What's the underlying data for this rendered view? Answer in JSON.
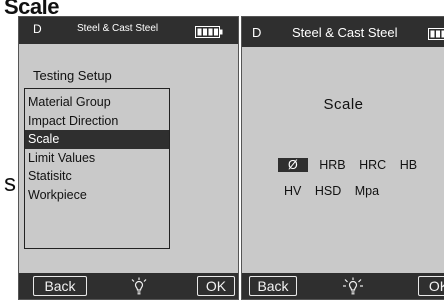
{
  "heading": "Scale",
  "side_letter": "s",
  "left_device": {
    "mode": "D",
    "title": "Steel & Cast Steel",
    "setup_title": "Testing Setup",
    "menu": [
      "Material Group",
      "Impact Direction",
      "Scale",
      "Limit Values",
      "Statisitc",
      "Workpiece"
    ],
    "selected_index": 2,
    "back_label": "Back",
    "ok_label": "OK",
    "icons": [
      "battery-icon",
      "light-bulb-icon"
    ]
  },
  "right_device": {
    "mode": "D",
    "title": "Steel & Cast Steel",
    "screen_title": "Scale",
    "scale_row1": [
      "Ø",
      "HRB",
      "HRC",
      "HB"
    ],
    "scale_row2": [
      "HV",
      "HSD",
      "Mpa"
    ],
    "selected_scale": "Ø",
    "back_label": "Back",
    "ok_label": "OK",
    "icons": [
      "battery-icon",
      "light-bulb-icon"
    ]
  },
  "colors": {
    "bar": "#2f2f2f",
    "screen": "#c9c9c9",
    "highlight": "#2f2f2f"
  }
}
